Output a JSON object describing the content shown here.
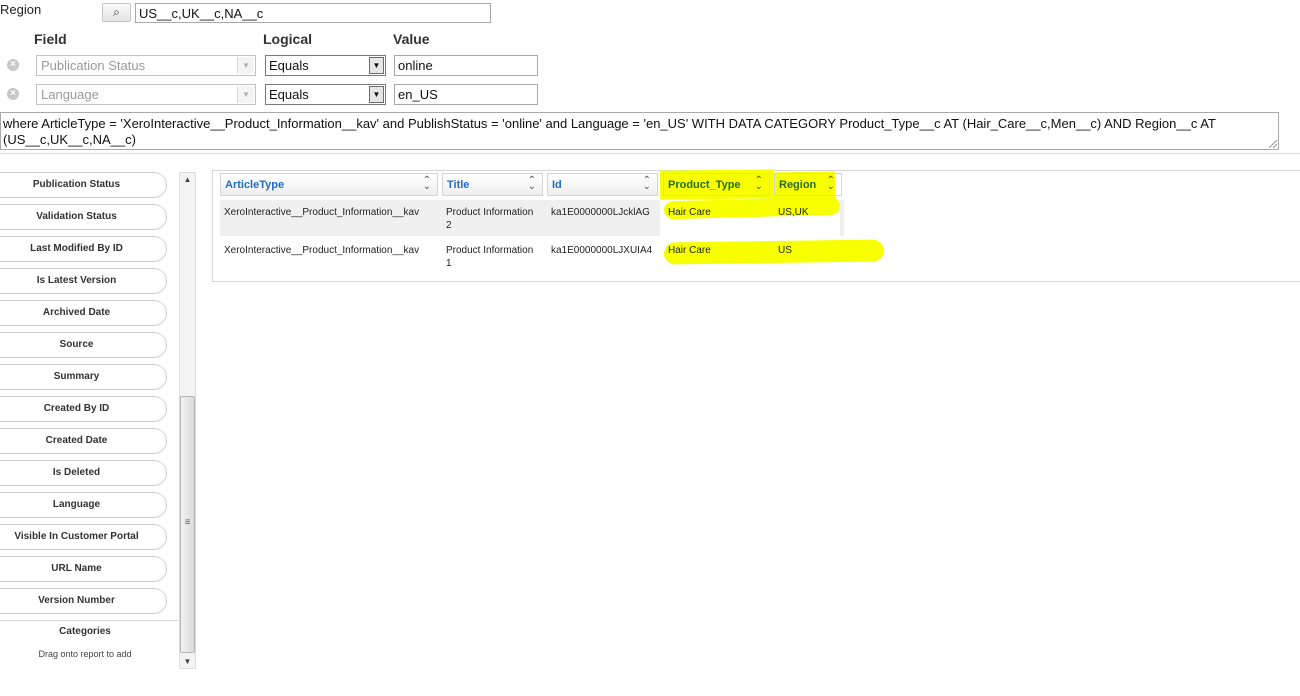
{
  "region": {
    "label": "Region",
    "lookup_glyph": "⌕",
    "value": "US__c,UK__c,NA__c"
  },
  "filter_headers": {
    "field": "Field",
    "logical": "Logical",
    "value": "Value"
  },
  "filters": [
    {
      "field": "Publication Status",
      "operator": "Equals",
      "value": "online"
    },
    {
      "field": "Language",
      "operator": "Equals",
      "value": "en_US"
    }
  ],
  "query_text": "where ArticleType = 'XeroInteractive__Product_Information__kav' and PublishStatus = 'online' and Language = 'en_US' WITH DATA CATEGORY Product_Type__c AT (Hair_Care__c,Men__c) AND Region__c AT (US__c,UK__c,NA__c)",
  "field_list": [
    "Publication Status",
    "Validation Status",
    "Last Modified By ID",
    "Is Latest Version",
    "Archived Date",
    "Source",
    "Summary",
    "Created By ID",
    "Created Date",
    "Is Deleted",
    "Language",
    "Visible In Customer Portal",
    "URL Name",
    "Version Number"
  ],
  "categories": {
    "label": "Categories",
    "hint": "Drag onto report to add"
  },
  "table": {
    "columns": [
      "ArticleType",
      "Title",
      "Id",
      "Product_Type",
      "Region"
    ],
    "rows": [
      {
        "article_type": "XeroInteractive__Product_Information__kav",
        "title_line1": "Product Information",
        "title_line2": "2",
        "id": "ka1E0000000LJcklAG",
        "product_type": "Hair Care",
        "region": "US,UK"
      },
      {
        "article_type": "XeroInteractive__Product_Information__kav",
        "title_line1": "Product Information",
        "title_line2": "1",
        "id": "ka1E0000000LJXUIA4",
        "product_type": "Hair Care",
        "region": "US"
      }
    ]
  },
  "colors": {
    "link_blue": "#1f6dc4",
    "highlight_yellow": "#f7ff00",
    "header_green": "#2a6b1c"
  }
}
